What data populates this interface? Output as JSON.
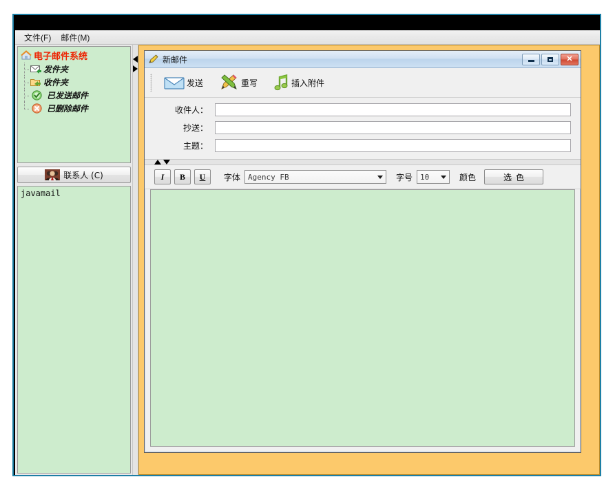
{
  "window": {
    "menubar": [
      {
        "label": "文件(F)",
        "name": "menu-file"
      },
      {
        "label": "邮件(M)",
        "name": "menu-mail"
      }
    ]
  },
  "sidebar": {
    "tree": {
      "root": {
        "label": "电子邮件系统",
        "icon": "home-icon",
        "color": "#ee2200"
      },
      "children": [
        {
          "label": "发件夹",
          "icon": "outbox-envelope-icon"
        },
        {
          "label": "收件夹",
          "icon": "inbox-folder-icon"
        },
        {
          "label": "已发送邮件",
          "icon": "sent-check-icon"
        },
        {
          "label": "已删除邮件",
          "icon": "deleted-x-icon"
        }
      ]
    },
    "contacts_button": {
      "label": "联系人 (C)",
      "icon": "contacts-avatar-icon"
    },
    "contacts_list": [
      "javamail"
    ]
  },
  "child_window": {
    "title": "新邮件",
    "title_icon": "compose-pencil-icon",
    "controls": {
      "minimize": "—",
      "maximize": "□",
      "close": "✕"
    },
    "toolbar": [
      {
        "label": "发送",
        "icon": "envelope-icon",
        "name": "send-button"
      },
      {
        "label": "重写",
        "icon": "pencils-icon",
        "name": "rewrite-button"
      },
      {
        "label": "插入附件",
        "icon": "music-note-icon",
        "name": "insert-attachment-button"
      }
    ],
    "fields": [
      {
        "label": "收件人：",
        "value": "",
        "name": "to-field"
      },
      {
        "label": "抄送：",
        "value": "",
        "name": "cc-field"
      },
      {
        "label": "主题：",
        "value": "",
        "name": "subject-field"
      }
    ],
    "format_bar": {
      "italic_label": "I",
      "bold_label": "B",
      "underline_label": "U",
      "font_label": "字体",
      "font_value": "Agency FB",
      "size_label": "字号",
      "size_value": "10",
      "color_label": "颜色",
      "color_button_label": "选色"
    },
    "body": {
      "value": ""
    }
  },
  "colors": {
    "panel_green": "#cdeccd",
    "mdi_orange": "#fcc96b",
    "frame_teal": "#1d7fa5",
    "title_red": "#ee2200"
  }
}
